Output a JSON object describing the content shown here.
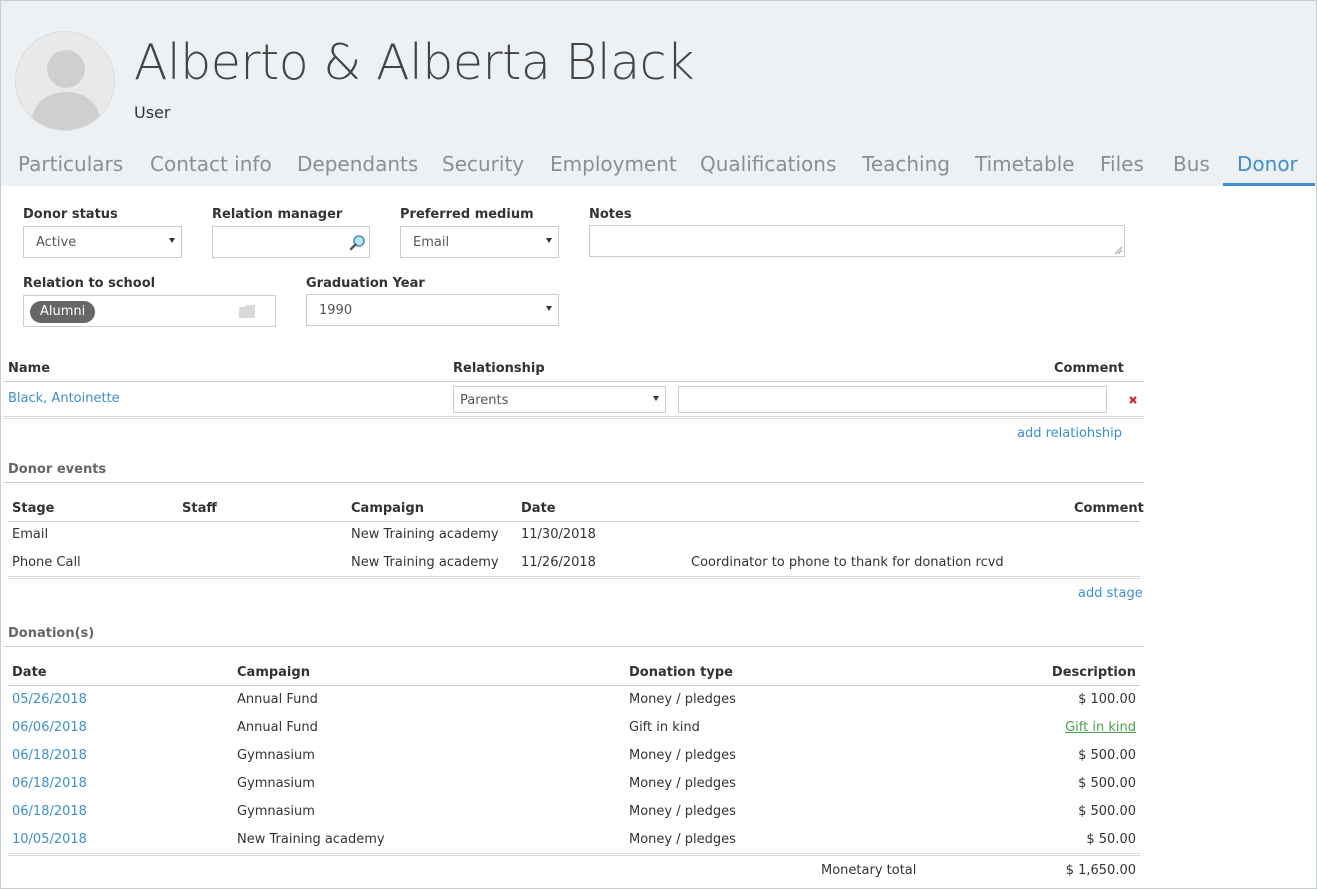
{
  "header": {
    "title": "Alberto & Alberta Black",
    "subtitle": "User"
  },
  "tabs": [
    {
      "label": "Particulars"
    },
    {
      "label": "Contact info"
    },
    {
      "label": "Dependants"
    },
    {
      "label": "Security"
    },
    {
      "label": "Employment"
    },
    {
      "label": "Qualifications"
    },
    {
      "label": "Teaching"
    },
    {
      "label": "Timetable"
    },
    {
      "label": "Files"
    },
    {
      "label": "Bus"
    },
    {
      "label": "Donor"
    }
  ],
  "form": {
    "donor_status": {
      "label": "Donor status",
      "value": "Active"
    },
    "relation_manager": {
      "label": "Relation manager",
      "value": ""
    },
    "preferred_medium": {
      "label": "Preferred medium",
      "value": "Email"
    },
    "notes": {
      "label": "Notes",
      "value": ""
    },
    "relation_to_school": {
      "label": "Relation to school",
      "value": "Alumni"
    },
    "graduation_year": {
      "label": "Graduation Year",
      "value": "1990"
    }
  },
  "relationships": {
    "headers": {
      "name": "Name",
      "relationship": "Relationship",
      "comment": "Comment"
    },
    "rows": [
      {
        "name": "Black, Antoinette",
        "relationship": "Parents",
        "comment": ""
      }
    ],
    "add_label": "add relatiohship"
  },
  "donor_events": {
    "title": "Donor events",
    "headers": {
      "stage": "Stage",
      "staff": "Staff",
      "campaign": "Campaign",
      "date": "Date",
      "comment": "Comment"
    },
    "rows": [
      {
        "stage": "Email",
        "staff": "",
        "campaign": "New Training academy",
        "date": "11/30/2018",
        "comment": ""
      },
      {
        "stage": "Phone Call",
        "staff": "",
        "campaign": "New Training academy",
        "date": "11/26/2018",
        "comment": "Coordinator to phone to thank for donation rcvd"
      }
    ],
    "add_label": "add stage"
  },
  "donations": {
    "title": "Donation(s)",
    "headers": {
      "date": "Date",
      "campaign": "Campaign",
      "type": "Donation type",
      "description": "Description"
    },
    "rows": [
      {
        "date": "05/26/2018",
        "campaign": "Annual Fund",
        "type": "Money / pledges",
        "description": "$ 100.00",
        "description_link": false
      },
      {
        "date": "06/06/2018",
        "campaign": "Annual Fund",
        "type": "Gift in kind",
        "description": "Gift in kind",
        "description_link": true
      },
      {
        "date": "06/18/2018",
        "campaign": "Gymnasium",
        "type": "Money / pledges",
        "description": "$ 500.00",
        "description_link": false
      },
      {
        "date": "06/18/2018",
        "campaign": "Gymnasium",
        "type": "Money / pledges",
        "description": "$ 500.00",
        "description_link": false
      },
      {
        "date": "06/18/2018",
        "campaign": "Gymnasium",
        "type": "Money / pledges",
        "description": "$ 500.00",
        "description_link": false
      },
      {
        "date": "10/05/2018",
        "campaign": "New Training academy",
        "type": "Money / pledges",
        "description": "$ 50.00",
        "description_link": false
      }
    ],
    "total_label": "Monetary total",
    "total_value": "$ 1,650.00"
  },
  "colors": {
    "accent": "#3d8fd1",
    "header_bg": "#eef1f4",
    "link_green": "#4aa34a",
    "delete_red": "#cc2222"
  }
}
